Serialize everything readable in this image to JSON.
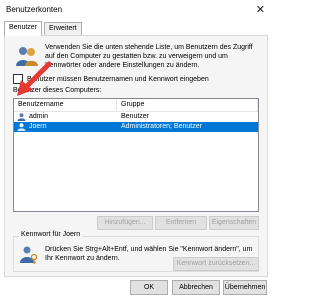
{
  "window": {
    "title": "Benutzerkonten"
  },
  "tabs": [
    {
      "label": "Benutzer"
    },
    {
      "label": "Erweitert"
    }
  ],
  "intro_text": "Verwenden Sie die unten stehende Liste, um Benutzern des Zugriff auf den Computer zu gestatten bzw. zu verweigern und um Kennwörter oder andere Einstellungen zu ändern.",
  "checkbox": {
    "label": "Benutzer müssen Benutzernamen und Kennwort eingeben",
    "checked": false
  },
  "users_section": {
    "label": "Benutzer dieses Computers:"
  },
  "table": {
    "columns": [
      "Benutzername",
      "Gruppe"
    ],
    "rows": [
      {
        "name": "admin",
        "group": "Benutzer",
        "selected": false
      },
      {
        "name": "Joern",
        "group": "Administratoren; Benutzer",
        "selected": true
      }
    ]
  },
  "user_buttons": {
    "add": "Hinzufügen...",
    "remove": "Entfernen",
    "properties": "Eigenschaften"
  },
  "password_group": {
    "title": "Kennwort für Joern",
    "text": "Drücken Sie Strg+Alt+Entf, und wählen Sie \"Kennwort ändern\", um Ihr Kennwort zu ändern.",
    "reset_button": "Kennwort zurücksetzen..."
  },
  "dialog_buttons": {
    "ok": "OK",
    "cancel": "Abbrechen",
    "apply": "Übernehmen"
  },
  "colors": {
    "selection": "#0078d7",
    "annotation_arrow": "#e53935"
  }
}
